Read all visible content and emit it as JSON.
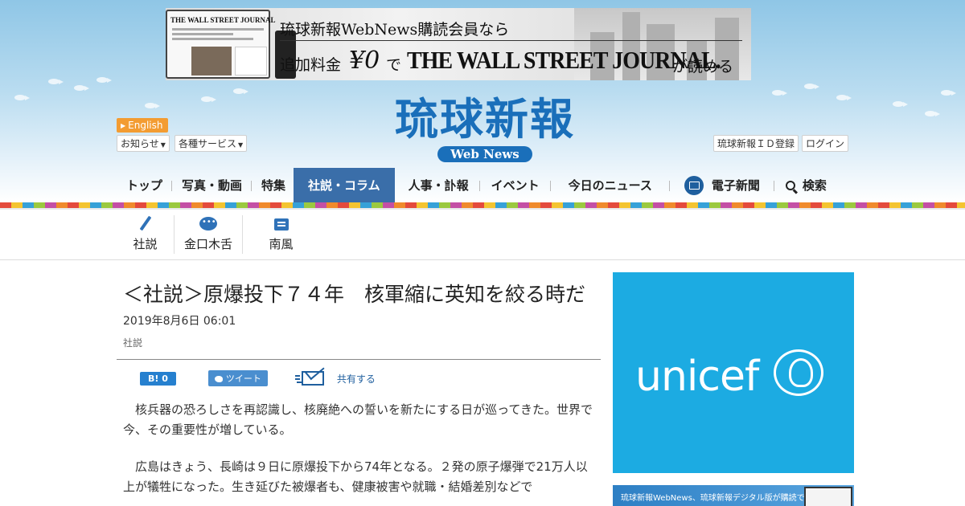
{
  "ad_banner": {
    "line1": "琉球新報WebNews購読会員なら",
    "line2_prefix": "追加料金",
    "price": "¥0",
    "line2_de": "で",
    "brand": "THE WALL STREET JOURNAL.",
    "line2_suffix": "が読める",
    "laptop_masthead": "THE WALL STREET JOURNAL"
  },
  "logo": {
    "title": "琉球新報",
    "subtitle": "Web News"
  },
  "utility": {
    "english": "English",
    "notices": "お知らせ",
    "services": "各種サービス",
    "register": "琉球新報ＩＤ登録",
    "login": "ログイン"
  },
  "nav": {
    "items": [
      "トップ",
      "写真・動画",
      "特集",
      "社説・コラム",
      "人事・訃報",
      "イベント",
      "今日のニュース"
    ],
    "active_index": 3,
    "digital": "電子新聞",
    "search": "検索"
  },
  "subnav": {
    "items": [
      "社説",
      "金口木舌",
      "南風"
    ]
  },
  "article": {
    "title": "＜社説＞原爆投下７４年　核軍縮に英知を絞る時だ",
    "date": "2019年8月6日 06:01",
    "category": "社説",
    "share": {
      "hatena": "B! 0",
      "tweet": "ツイート",
      "share": "共有する"
    },
    "paragraphs": [
      "核兵器の恐ろしさを再認識し、核廃絶への誓いを新たにする日が巡ってきた。世界で今、その重要性が増している。",
      "広島はきょう、長崎は９日に原爆投下から74年となる。２発の原子爆弾で21万人以上が犠牲になった。生き延びた被爆者も、健康被害や就職・結婚差別などで"
    ]
  },
  "sidebar": {
    "unicef": "unicef",
    "ryukyu_ad": "琉球新報WebNews、琉球新報デジタル版が購読できる"
  },
  "colors": {
    "brand_blue": "#1a6fba",
    "nav_active": "#3a6ea9",
    "english_badge": "#f39c32",
    "unicef_blue": "#1cabe2"
  }
}
